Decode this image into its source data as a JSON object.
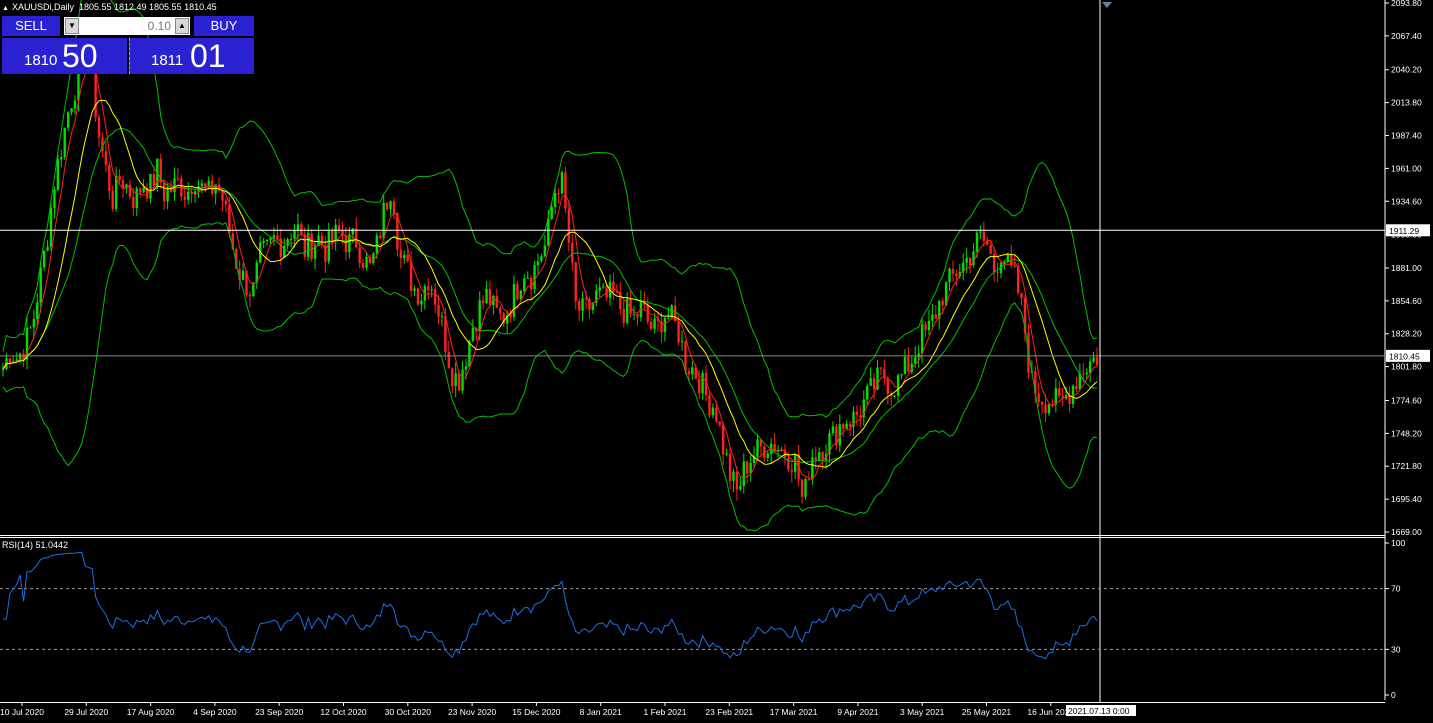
{
  "header": {
    "title": "XAUUSDi,Daily",
    "ohlc": "1805.55 1812.49 1805.55 1810.45"
  },
  "trade_panel": {
    "sell_label": "SELL",
    "buy_label": "BUY",
    "lot": "0.10",
    "sell_price_small": "1810",
    "sell_price_big": "50",
    "buy_price_small": "1811",
    "buy_price_big": "01"
  },
  "rsi": {
    "label": "RSI(14) 51.0442",
    "levels": [
      100,
      70,
      30,
      0
    ]
  },
  "chart_data": {
    "type": "candlestick",
    "y_ticks": [
      "2093.80",
      "2067.40",
      "2040.20",
      "2013.80",
      "1987.40",
      "1961.00",
      "1934.60",
      "1908.00",
      "1881.00",
      "1854.60",
      "1828.20",
      "1801.80",
      "1774.60",
      "1748.20",
      "1721.80",
      "1695.40",
      "1669.00"
    ],
    "ylim": [
      1669.0,
      2093.8
    ],
    "x_ticks": [
      "10 Jul 2020",
      "29 Jul 2020",
      "17 Aug 2020",
      "4 Sep 2020",
      "23 Sep 2020",
      "12 Oct 2020",
      "30 Oct 2020",
      "23 Nov 2020",
      "15 Dec 2020",
      "8 Jan 2021",
      "1 Feb 2021",
      "23 Feb 2021",
      "17 Mar 2021",
      "9 Apr 2021",
      "3 May 2021",
      "25 May 2021",
      "16 Jun 2021"
    ],
    "crosshair": {
      "price": "1911.29",
      "time": "2021.07.13 0:00"
    },
    "last_price": "1810.45",
    "price_path": [
      1800,
      1815,
      1808,
      1820,
      1835,
      1870,
      1905,
      1950,
      1980,
      2010,
      2030,
      2060,
      2040,
      1990,
      1960,
      1935,
      1955,
      1945,
      1935,
      1950,
      1945,
      1960,
      1940,
      1945,
      1950,
      1940,
      1955,
      1945,
      1940,
      1950,
      1935,
      1905,
      1880,
      1870,
      1860,
      1890,
      1895,
      1905,
      1900,
      1910,
      1915,
      1895,
      1900,
      1905,
      1895,
      1905,
      1910,
      1900,
      1905,
      1890,
      1880,
      1900,
      1930,
      1950,
      1890,
      1880,
      1865,
      1860,
      1875,
      1855,
      1830,
      1800,
      1790,
      1810,
      1835,
      1850,
      1860,
      1845,
      1840,
      1850,
      1865,
      1880,
      1875,
      1890,
      1900,
      1940,
      1955,
      1905,
      1850,
      1845,
      1850,
      1860,
      1855,
      1860,
      1850,
      1845,
      1840,
      1850,
      1835,
      1830,
      1845,
      1840,
      1830,
      1805,
      1800,
      1790,
      1775,
      1770,
      1740,
      1715,
      1700,
      1720,
      1730,
      1735,
      1740,
      1740,
      1735,
      1730,
      1725,
      1690,
      1730,
      1735,
      1740,
      1745,
      1755,
      1760,
      1760,
      1770,
      1780,
      1790,
      1795,
      1785,
      1790,
      1800,
      1810,
      1825,
      1830,
      1845,
      1860,
      1870,
      1880,
      1885,
      1895,
      1905,
      1900,
      1880,
      1895,
      1880,
      1870,
      1840,
      1790,
      1780,
      1775,
      1775,
      1770,
      1780,
      1790,
      1800,
      1805,
      1810
    ],
    "colors": {
      "bull": "#00e000",
      "bear": "#ff2020",
      "ma_fast": "#ff2020",
      "ma_slow": "#ffff00",
      "bands": "#00c000",
      "rsi": "#1e6ee6"
    }
  }
}
